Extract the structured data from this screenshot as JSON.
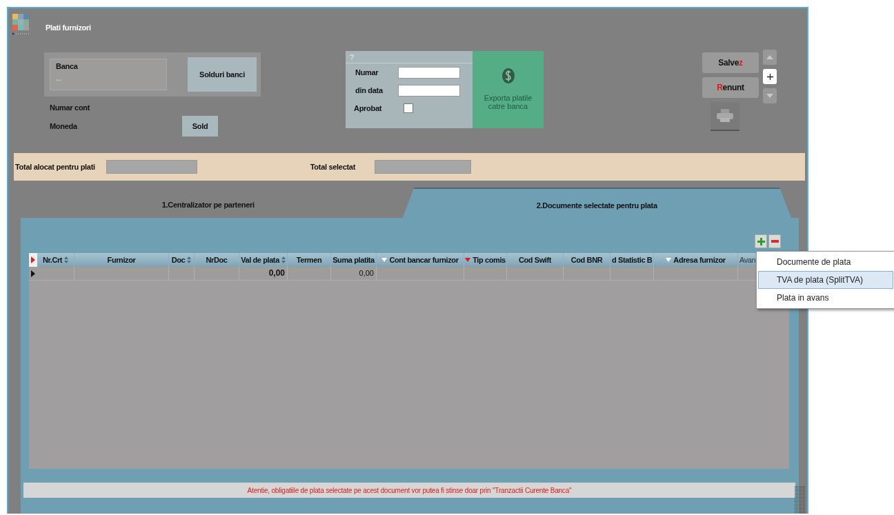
{
  "window": {
    "title": "Plati furnizori"
  },
  "bank": {
    "label": "Banca",
    "value": "...",
    "balances_button": "Solduri banci"
  },
  "account_label": "Numar cont",
  "currency_label": "Moneda",
  "balance_button": "Sold",
  "document": {
    "header": "?",
    "number_label": "Numar",
    "date_label": "din data",
    "approved_label": "Aprobat",
    "approved": false
  },
  "export_button": {
    "label": "Exporta platile catre banca",
    "disabled": true
  },
  "actions": {
    "save": {
      "label_start": "Salve",
      "hotkey": "z"
    },
    "cancel": {
      "hotkey": "R",
      "label_end": "enunt"
    }
  },
  "record_nav": [
    {
      "kind": "up",
      "disabled": true
    },
    {
      "kind": "add",
      "disabled": false
    },
    {
      "kind": "down",
      "disabled": true
    }
  ],
  "totals": {
    "allocated_label": "Total alocat pentru plati",
    "selected_label": "Total selectat"
  },
  "tabs": [
    {
      "label": "1.Centralizator pe parteneri",
      "selected": false
    },
    {
      "label": "2.Documente selectate pentru plata",
      "selected": true
    }
  ],
  "table": {
    "columns": [
      {
        "label": "Nr.Crt",
        "kind": "sort"
      },
      {
        "label": "Furnizor",
        "kind": "plain"
      },
      {
        "label": "Doc",
        "kind": "sort"
      },
      {
        "label": "NrDoc",
        "kind": "plain"
      },
      {
        "label": "Val de plata",
        "kind": "sort"
      },
      {
        "label": "Termen",
        "kind": "plain"
      },
      {
        "label": "Suma platita",
        "kind": "plain"
      },
      {
        "label": "Cont bancar furnizor",
        "kind": "filter"
      },
      {
        "label": "Tip comis",
        "kind": "filter_active"
      },
      {
        "label": "Cod Swift",
        "kind": "plain"
      },
      {
        "label": "Cod BNR",
        "kind": "plain"
      },
      {
        "label": "d Statistic B",
        "kind": "plain"
      },
      {
        "label": "Adresa furnizor",
        "kind": "filter"
      },
      {
        "label": "Avan",
        "kind": "plain"
      }
    ],
    "rows": [
      {
        "current": true,
        "cells": [
          null,
          null,
          null,
          null,
          {
            "text": "0,00",
            "bold": true
          },
          null,
          {
            "text": "0,00",
            "bold": false
          }
        ]
      }
    ]
  },
  "add_menu": {
    "items": [
      {
        "label": "Documente de plata",
        "selected": false
      },
      {
        "label": "TVA de plata (SplitTVA)",
        "selected": true
      },
      {
        "label": "Plata in avans",
        "selected": false
      }
    ]
  },
  "warning": "Atentie, obligatiile de plata selectate pe acest document vor putea fi stinse doar prin \"Tranzactii Curente Banca\""
}
